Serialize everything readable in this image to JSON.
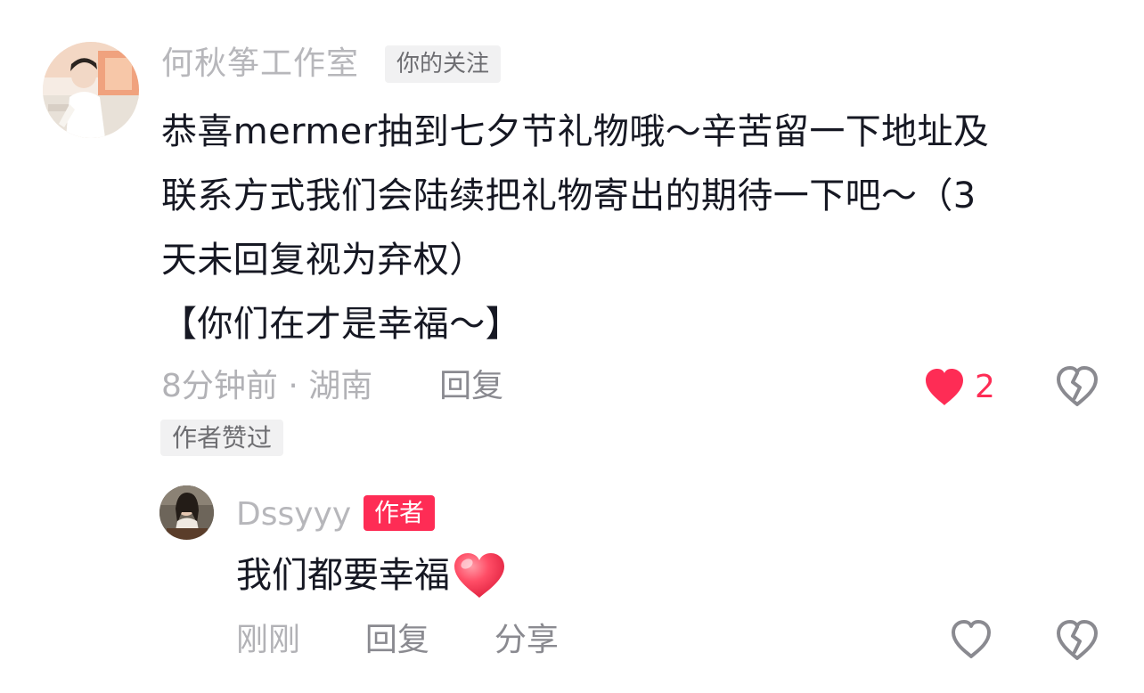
{
  "comment": {
    "author": "何秋筝工作室",
    "follow_badge": "你的关注",
    "text_line1": "恭喜mermer抽到七夕节礼物哦～辛苦留一下地址及",
    "text_line2": "联系方式我们会陆续把礼物寄出的期待一下吧～（3",
    "text_line3": "天未回复视为弃权）",
    "text_line4": "【你们在才是幸福～】",
    "time_location": "8分钟前 · 湖南",
    "reply_label": "回复",
    "like_count": "2",
    "liked": true,
    "author_liked_badge": "作者赞过"
  },
  "reply": {
    "author": "Dssyyy",
    "author_badge": "作者",
    "text": "我们都要幸福",
    "emoji": "heart-emoji",
    "time": "刚刚",
    "reply_label": "回复",
    "share_label": "分享",
    "liked": false
  },
  "colors": {
    "accent": "#fe2c55",
    "muted_text": "#b2b2b6",
    "text": "#161823",
    "badge_bg": "#f1f1f2"
  }
}
